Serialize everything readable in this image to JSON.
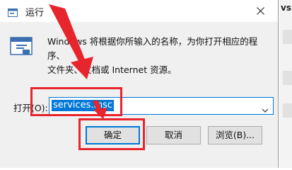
{
  "window": {
    "title": "运行",
    "close_icon": "close-icon",
    "app_icon": "run-app-icon"
  },
  "description": {
    "line1": "Windows 将根据你所输入的名称，为你打开相应的程序、",
    "line2": "文件夹、文档或 Internet 资源。"
  },
  "open_field": {
    "label": "打开(O):",
    "value": "services.msc",
    "dropdown_icon": "chevron-down-icon"
  },
  "buttons": {
    "ok": "确定",
    "cancel": "取消",
    "browse": "浏览(B)..."
  },
  "background": {
    "edge_text": "vs"
  },
  "annotation_color": "#e8242c",
  "accent_color": "#0078d7"
}
